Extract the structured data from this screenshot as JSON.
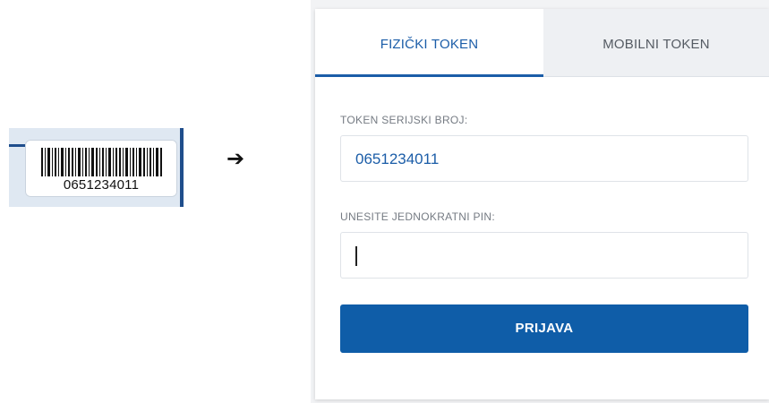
{
  "sticker": {
    "serial_number": "0651234011",
    "barcode_icon": "barcode-icon"
  },
  "arrow_icon": "arrow-right-icon",
  "login_panel": {
    "tabs": [
      {
        "label": "FIZIČKI TOKEN",
        "active": true
      },
      {
        "label": "MOBILNI TOKEN",
        "active": false
      }
    ],
    "serial_field": {
      "label": "TOKEN SERIJSKI BROJ:",
      "value": "0651234011"
    },
    "pin_field": {
      "label": "UNESITE JEDNOKRATNI PIN:",
      "value": ""
    },
    "submit_label": "PRIJAVA"
  },
  "colors": {
    "accent": "#1b5da8",
    "button": "#0f5da8",
    "label": "#757b83",
    "sticker_background": "#dfe8f2"
  }
}
